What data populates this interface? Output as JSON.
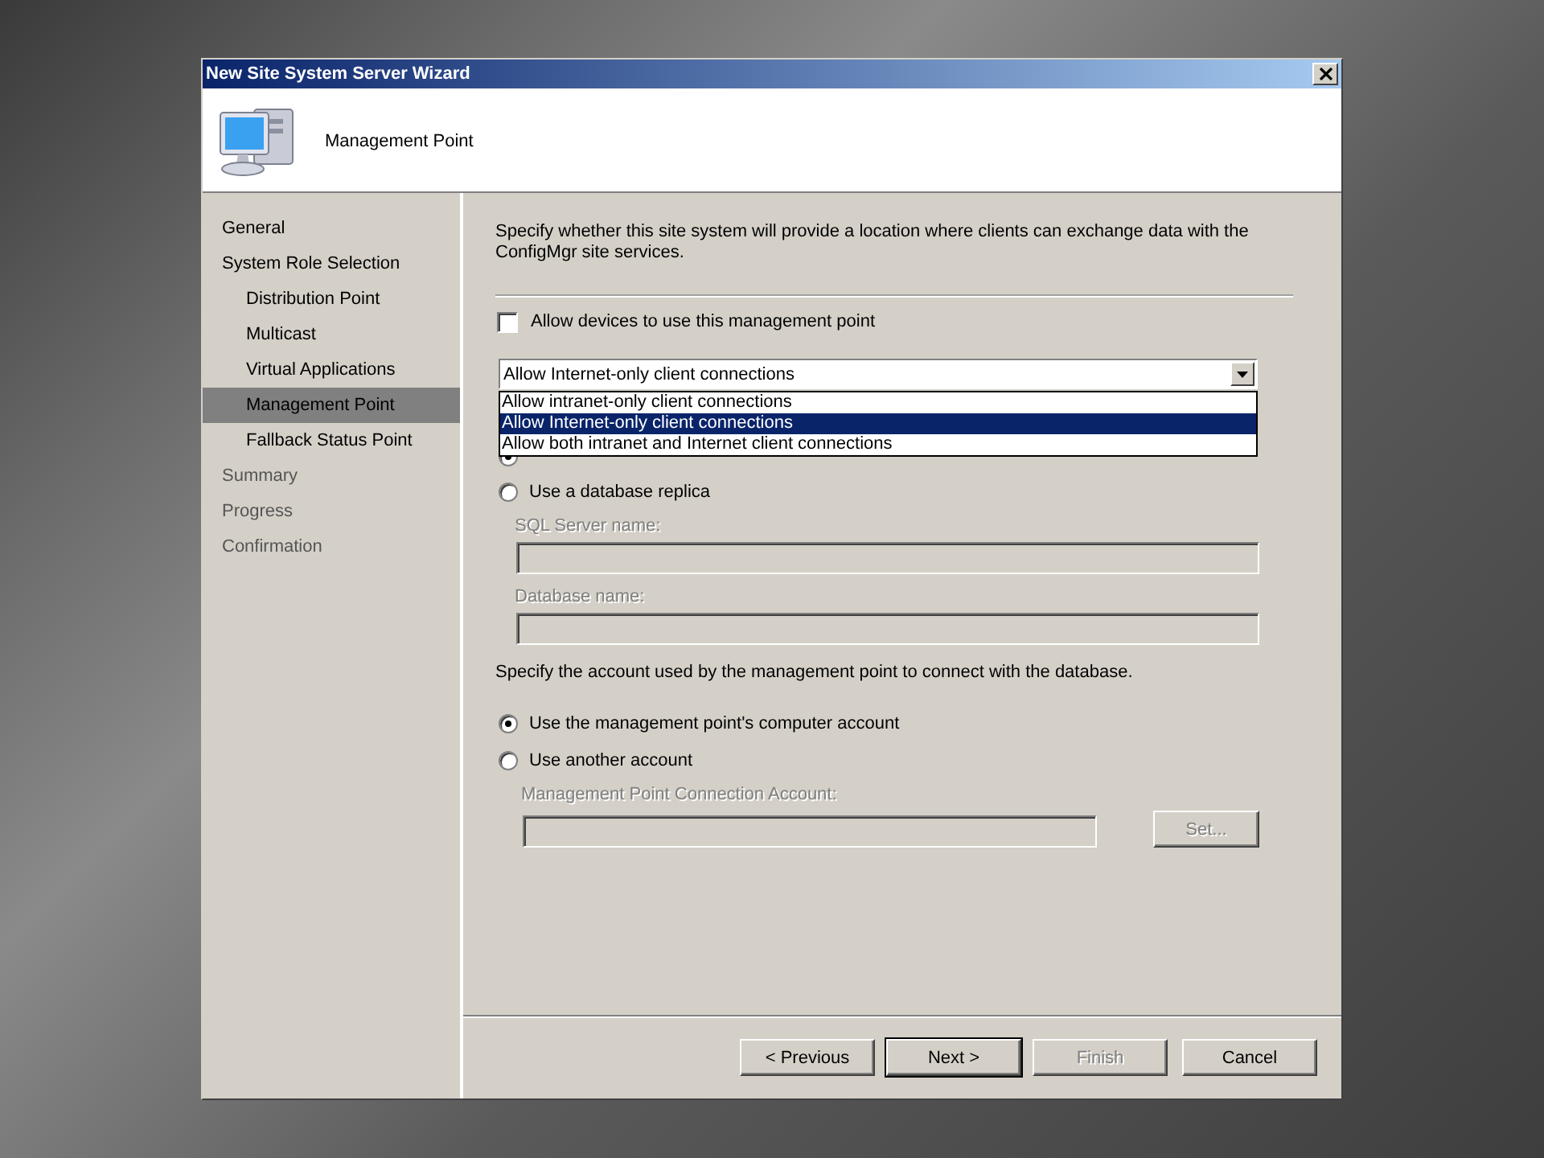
{
  "window": {
    "title": "New Site System Server Wizard"
  },
  "header": {
    "title": "Management Point"
  },
  "sidebar": {
    "items": [
      {
        "label": "General",
        "selected": false,
        "disabled": false
      },
      {
        "label": "System Role Selection",
        "selected": false,
        "disabled": false,
        "children": [
          {
            "label": "Distribution Point",
            "selected": false,
            "disabled": false
          },
          {
            "label": "Multicast",
            "selected": false,
            "disabled": false
          },
          {
            "label": "Virtual Applications",
            "selected": false,
            "disabled": false
          },
          {
            "label": "Management Point",
            "selected": true,
            "disabled": false
          },
          {
            "label": "Fallback Status Point",
            "selected": false,
            "disabled": false
          }
        ]
      },
      {
        "label": "Summary",
        "selected": false,
        "disabled": true
      },
      {
        "label": "Progress",
        "selected": false,
        "disabled": true
      },
      {
        "label": "Confirmation",
        "selected": false,
        "disabled": true
      }
    ]
  },
  "intro": "Specify whether this site system will provide a location where clients can exchange data with the ConfigMgr site services.",
  "devices_checkbox": {
    "label": "Allow devices to use this management point",
    "checked": false
  },
  "connection_combo": {
    "value": "Allow Internet-only client connections",
    "expanded": true,
    "options": [
      {
        "label": "Allow intranet-only client connections",
        "selected": false
      },
      {
        "label": "Allow Internet-only client connections",
        "selected": true
      },
      {
        "label": "Allow both intranet and Internet client connections",
        "selected": false
      }
    ]
  },
  "database_options": [
    {
      "selected": true
    },
    {
      "label": "Use a database replica",
      "selected": false
    }
  ],
  "replica_fields": [
    {
      "label": "SQL Server name:",
      "disabled": true
    },
    {
      "label": "Database name:",
      "disabled": true
    }
  ],
  "account_prompt": "Specify the account used by the management point to connect with the database.",
  "account_options": [
    {
      "label": "Use the management point's computer account",
      "selected": true
    },
    {
      "label": "Use another account",
      "selected": false
    }
  ],
  "account_field": {
    "label": "Management Point Connection Account:",
    "disabled": true
  },
  "set_button": {
    "label": "Set...",
    "disabled": true
  },
  "buttons": [
    {
      "label": "< Previous",
      "disabled": false,
      "default": false
    },
    {
      "label": "Next >",
      "disabled": false,
      "default": true
    },
    {
      "label": "Finish",
      "disabled": true,
      "default": false
    },
    {
      "label": "Cancel",
      "disabled": false,
      "default": false
    }
  ]
}
